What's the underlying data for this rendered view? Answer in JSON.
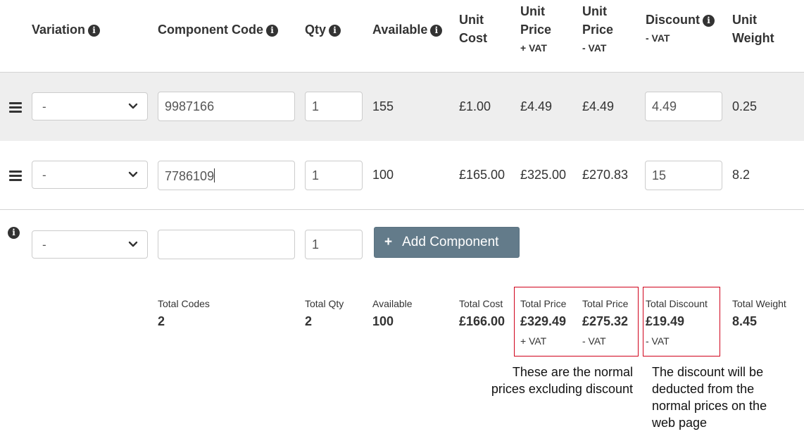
{
  "headers": {
    "variation": "Variation",
    "component_code": "Component Code",
    "qty": "Qty",
    "available": "Available",
    "unit_cost": [
      "Unit",
      "Cost"
    ],
    "unit_price_inc": [
      "Unit",
      "Price",
      "+ VAT"
    ],
    "unit_price_ex": [
      "Unit",
      "Price",
      "- VAT"
    ],
    "discount": [
      "Discount",
      "- VAT"
    ],
    "unit_weight": [
      "Unit",
      "Weight"
    ]
  },
  "rows": [
    {
      "variation": "-",
      "code": "9987166",
      "qty": "1",
      "available": "155",
      "unit_cost": "£1.00",
      "price_inc": "£4.49",
      "price_ex": "£4.49",
      "discount": "4.49",
      "weight": "0.25"
    },
    {
      "variation": "-",
      "code": "7786109",
      "qty": "1",
      "available": "100",
      "unit_cost": "£165.00",
      "price_inc": "£325.00",
      "price_ex": "£270.83",
      "discount": "15",
      "weight": "8.2"
    }
  ],
  "new_row": {
    "variation": "-",
    "code": "",
    "qty": "1",
    "add_button": "Add Component"
  },
  "totals": {
    "codes_label": "Total Codes",
    "codes": "2",
    "qty_label": "Total Qty",
    "qty": "2",
    "available_label": "Available",
    "available": "100",
    "cost_label": "Total Cost",
    "cost": "£166.00",
    "price_inc_label": "Total Price",
    "price_inc": "£329.49",
    "price_inc_sub": "+ VAT",
    "price_ex_label": "Total Price",
    "price_ex": "£275.32",
    "price_ex_sub": "- VAT",
    "discount_label": "Total Discount",
    "discount": "£19.49",
    "discount_sub": "- VAT",
    "weight_label": "Total Weight",
    "weight": "8.45"
  },
  "notes": {
    "prices": [
      "These are the normal",
      "prices excluding discount"
    ],
    "discount": [
      "The discount will be",
      "deducted from the",
      "normal prices on the",
      "web page"
    ]
  },
  "colors": {
    "annotation_box": "#d0021b",
    "button": "#637b8a",
    "row_highlight": "#eeeeee"
  }
}
